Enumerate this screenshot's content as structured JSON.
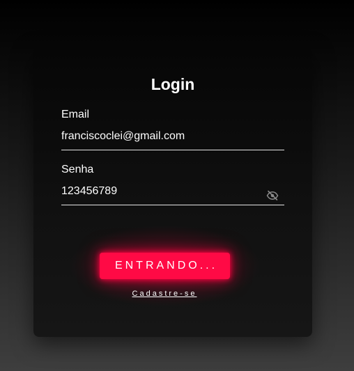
{
  "login": {
    "title": "Login",
    "email": {
      "label": "Email",
      "value": "franciscoclei@gmail.com"
    },
    "password": {
      "label": "Senha",
      "value": "123456789",
      "toggle_icon": "eye-off-icon"
    },
    "submit_label": "ENTRANDO...",
    "register_link": "Cadastre-se"
  },
  "colors": {
    "accent": "#ff0a45",
    "card": "#0e0e0e"
  }
}
